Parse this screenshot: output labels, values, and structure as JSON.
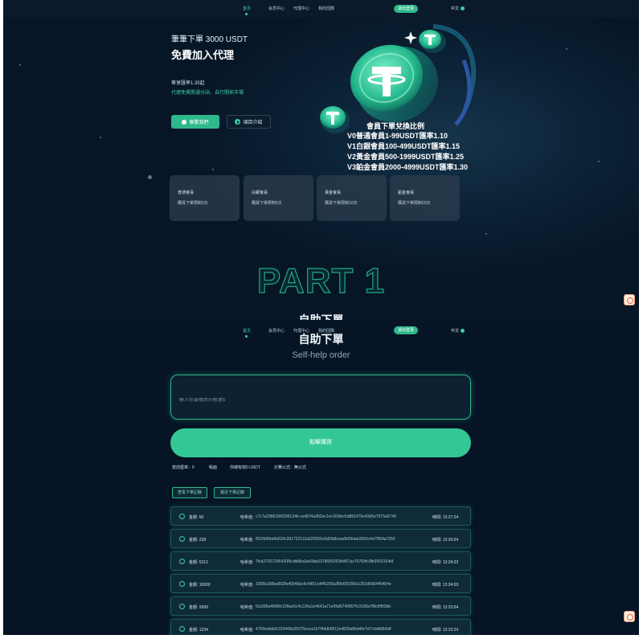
{
  "nav": {
    "links": [
      "首页",
      "会员中心",
      "代理中心",
      "我的団隊"
    ],
    "login": "退出登录",
    "lang": "中文"
  },
  "hero": {
    "subtitle": "筆筆下單 3000 USDT",
    "title": "免費加入代理",
    "rate": "尊享匯率1.35起",
    "rate_desc": "代理免費開通分站、自行開拓市場",
    "contact_btn": "聯繫我們",
    "project_btn": "項目介紹",
    "ratio_title": "會員下單兌換比例",
    "ratio_lines": [
      "V0普通會員1-99USDT匯率1.10",
      "V1白銀會員100-499USDT匯率1.15",
      "V2黃金會員500-1999USDT匯率1.25",
      "V3鉑金會員2000-4999USDT匯率1.30"
    ]
  },
  "tiers": [
    {
      "name": "普通會員",
      "desc": "購買下單限制3次"
    },
    {
      "name": "白銀會員",
      "desc": "購買下單限制5次"
    },
    {
      "name": "黃金會員",
      "desc": "購買下單限制10次"
    },
    {
      "name": "鉑金會員",
      "desc": "購買下單限制20次"
    }
  ],
  "section": {
    "part": "PART 1",
    "title": "自助下單",
    "title_en": "Self-help order",
    "placeholder": "輸入你要購買的數量$",
    "submit": "點擊購買"
  },
  "stats": {
    "rate": "當前匯率：0",
    "balance": "賬面",
    "available": "你總有效0 USDT",
    "formula": "計費公式：無公式"
  },
  "tabs": [
    "查看下單記錄",
    "最近下單記錄"
  ],
  "labels": {
    "amount": "金額:",
    "hash": "哈希值:",
    "time": "時間:"
  },
  "records": [
    {
      "amount": "60",
      "hash": "c7c7a29861842f36124b ced874a382ec1ec303fec5d891470e43d5e7675a6740",
      "time": "13:27:24"
    },
    {
      "amount": "238",
      "hash": "f532bf96e6b524c391722112a025555c9d29dbeaefb09dab2660c4cf7854a7250",
      "time": "13:26:54"
    },
    {
      "amount": "5312",
      "hash": "7fcd27027245420f9cdb8ba3a43da3378655263fe867ac70709fc0fb3953164bf",
      "time": "13:24:33"
    },
    {
      "amount": "10000",
      "hash": "3358a180ba802fa40948ac9c4861cdf45290a3f0b6f3290a1353d5d0445484e",
      "time": "13:24:03"
    },
    {
      "amount": "9999",
      "hash": "f2a399a4699fc109ae5c4c126a1e4641a71e09d6749807fc3100a7f8c8ff93bb",
      "time": "13:23:54"
    },
    {
      "amount": "1234",
      "hash": "4759edabb5193448a35075ecea1b7f4ddb9611e4830a8bd4fe7ef7cbdb8b5df",
      "time": "13:23:24"
    }
  ],
  "colors": {
    "accent": "#2fb88b",
    "background": "#071627"
  }
}
